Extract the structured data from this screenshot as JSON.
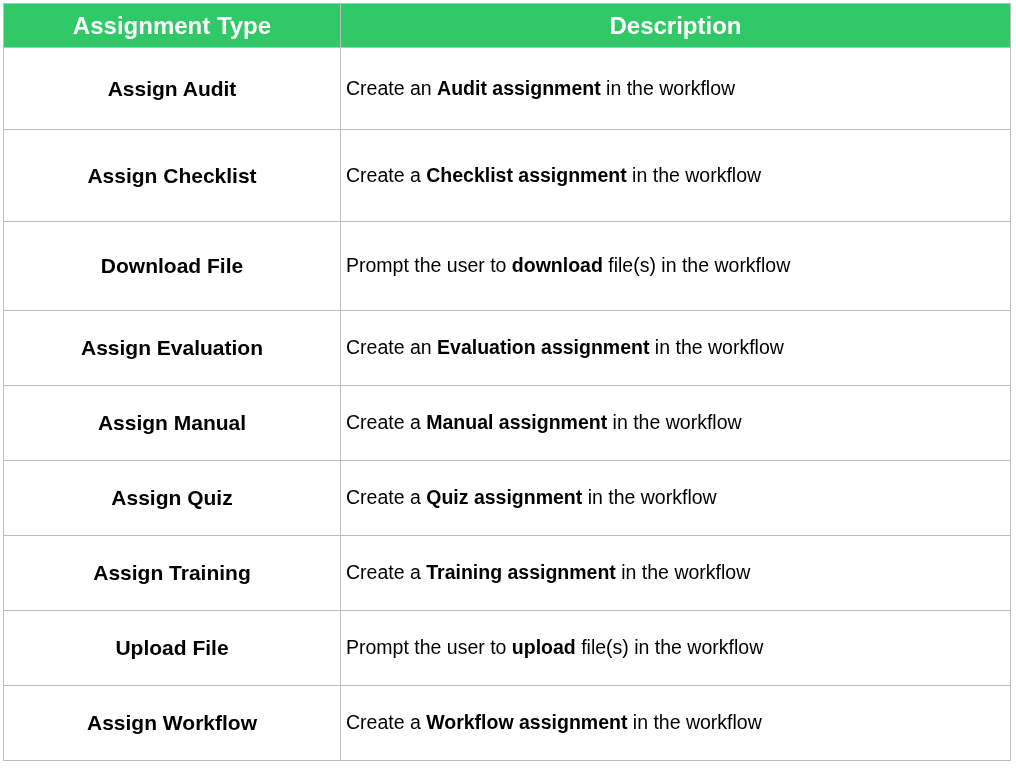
{
  "table": {
    "columns": [
      "Assignment Type",
      "Description"
    ],
    "rows": [
      {
        "type": "Assign Audit",
        "description": "Create an **Audit assignment** in the workflow"
      },
      {
        "type": "Assign Checklist",
        "description": "Create a **Checklist assignment** in the workflow"
      },
      {
        "type": "Download File",
        "description": "Prompt the user to **download** file(s) in the workflow"
      },
      {
        "type": "Assign Evaluation",
        "description": "Create an **Evaluation assignment** in the workflow"
      },
      {
        "type": "Assign Manual",
        "description": "Create a **Manual assignment** in the workflow"
      },
      {
        "type": "Assign Quiz",
        "description": "Create a **Quiz assignment** in the workflow"
      },
      {
        "type": "Assign Training",
        "description": "Create a **Training assignment** in the workflow"
      },
      {
        "type": "Upload File",
        "description": "Prompt the user to **upload** file(s) in the workflow"
      },
      {
        "type": "Assign Workflow",
        "description": "Create a **Workflow assignment** in the workflow"
      }
    ]
  }
}
